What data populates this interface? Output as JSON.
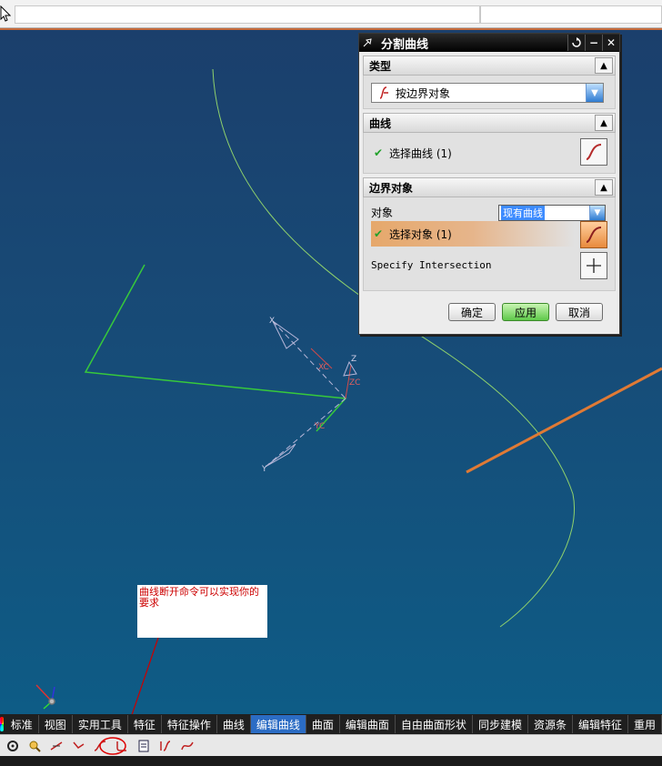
{
  "dialog": {
    "title": "分割曲线",
    "pin_icon": "pin-icon",
    "reset_icon": "reset-icon",
    "minimize_icon": "minimize-icon",
    "close_icon": "close-icon",
    "sections": {
      "type": {
        "header": "类型",
        "selected_value": "按边界对象"
      },
      "curve": {
        "header": "曲线",
        "select_label": "选择曲线 (1)"
      },
      "boundary": {
        "header": "边界对象",
        "object_label": "对象",
        "object_value": "现有曲线",
        "select_label": "选择对象 (1)",
        "specify_intersection_label": "Specify Intersection"
      }
    },
    "buttons": {
      "ok": "确定",
      "apply": "应用",
      "cancel": "取消"
    }
  },
  "annotation": {
    "text": "曲线断开命令可以实现你的要求"
  },
  "axis_labels": {
    "x": "X",
    "y": "Y",
    "z": "Z",
    "xc": "XC",
    "yc": "YC",
    "zc": "ZC"
  },
  "tabs": [
    {
      "label": "标准"
    },
    {
      "label": "视图"
    },
    {
      "label": "实用工具"
    },
    {
      "label": "特征"
    },
    {
      "label": "特征操作"
    },
    {
      "label": "曲线"
    },
    {
      "label": "编辑曲线",
      "active": true
    },
    {
      "label": "曲面"
    },
    {
      "label": "编辑曲面"
    },
    {
      "label": "自由曲面形状"
    },
    {
      "label": "同步建模"
    },
    {
      "label": "资源条"
    },
    {
      "label": "编辑特征"
    },
    {
      "label": "重用"
    }
  ],
  "colors": {
    "accent_orange": "#e07a35",
    "curve_green": "#8fd16c",
    "active_tab": "#2b6cc4"
  }
}
